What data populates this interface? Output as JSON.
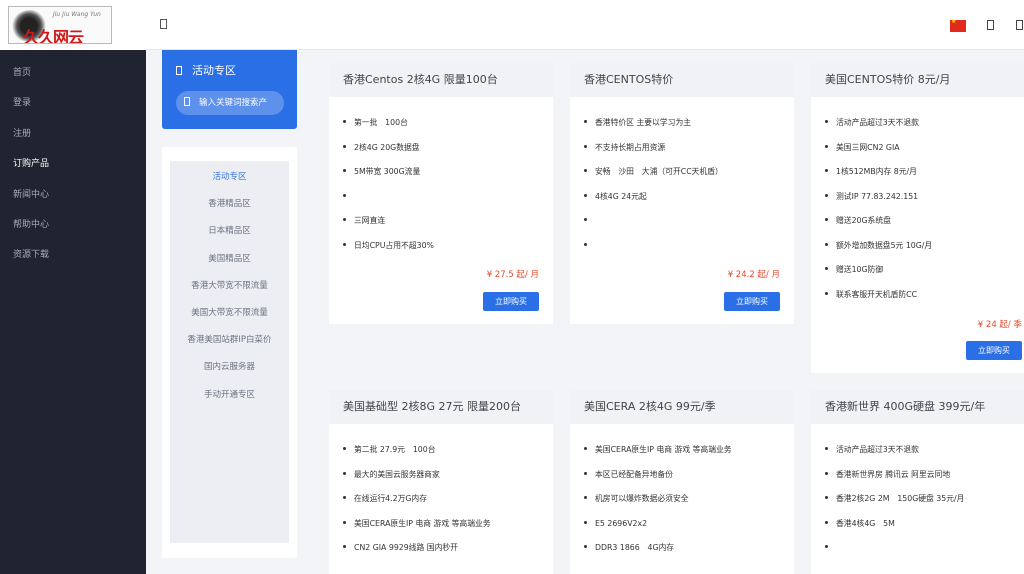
{
  "brand": {
    "logo_text": "久久网云",
    "logo_tagline": "Jiu Jiu Wang Yun"
  },
  "sidebar": {
    "items": [
      {
        "label": "首页"
      },
      {
        "label": "登录"
      },
      {
        "label": "注册"
      },
      {
        "label": "订购产品",
        "active": true
      },
      {
        "label": "新闻中心"
      },
      {
        "label": "帮助中心"
      },
      {
        "label": "资源下载"
      }
    ]
  },
  "topbar": {
    "menu_icon": "menu-toggle-icon",
    "language_flag": "china-flag",
    "icons": [
      "cart-icon",
      "user-icon"
    ]
  },
  "promo": {
    "title": "活动专区",
    "search_placeholder": "输入关键词搜索产"
  },
  "categories": [
    {
      "label": "活动专区",
      "active": true
    },
    {
      "label": "香港精品区"
    },
    {
      "label": "日本精品区"
    },
    {
      "label": "美国精品区"
    },
    {
      "label": "香港大带宽不限流量"
    },
    {
      "label": "美国大带宽不限流量"
    },
    {
      "label": "香港美国站群IP白菜价"
    },
    {
      "label": "国内云服务器"
    },
    {
      "label": "手动开通专区"
    }
  ],
  "colors": {
    "accent": "#2b6fe6",
    "price": "#e84a2c",
    "sidebar_bg": "#1f2430"
  },
  "products": [
    {
      "title": "香港Centos 2核4G 限量100台",
      "features": [
        "第一批　100台",
        "2核4G 20G数据盘",
        "5M带宽 300G流量",
        "",
        "三网直连",
        "日均CPU占用不超30%"
      ],
      "price": "¥ 27.5 起/ 月",
      "buy_label": "立即购买"
    },
    {
      "title": "香港CENTOS特价",
      "features": [
        "香港特价区 主要以学习为主",
        "不支持长期占用资源",
        "安畅　沙田　大浦（可开CC天机盾）",
        "4核4G 24元起",
        "",
        ""
      ],
      "price": "¥ 24.2 起/ 月",
      "buy_label": "立即购买"
    },
    {
      "title": "美国CENTOS特价 8元/月",
      "features": [
        "活动产品超过3天不退款",
        "美国三网CN2 GIA",
        "1核512MB内存 8元/月",
        "测试IP 77.83.242.151",
        "赠送20G系统盘",
        "额外增加数据盘5元 10G/月",
        "赠送10G防御",
        "联系客服开天机盾防CC"
      ],
      "price": "¥ 24 起/ 季",
      "buy_label": "立即购买"
    },
    {
      "title": "美国基础型 2核8G 27元 限量200台",
      "features": [
        "第二批 27.9元　100台",
        "最大的美国云服务器商家",
        "在线运行4.2万G内存",
        "美国CERA原生IP 电商 游戏 等高端业务",
        "CN2 GIA 9929线路 国内秒开"
      ],
      "price": "",
      "buy_label": ""
    },
    {
      "title": "美国CERA 2核4G 99元/季",
      "features": [
        "美国CERA原生IP 电商 游戏 等高端业务",
        "本区已经配备异地备份",
        "机房可以爆炸数据必须安全",
        "E5 2696V2x2",
        "DDR3 1866　4G内存"
      ],
      "price": "",
      "buy_label": ""
    },
    {
      "title": "香港新世界 400G硬盘 399元/年",
      "features": [
        "活动产品超过3天不退款",
        "香港新世界房 腾讯云 阿里云同地",
        "香港2核2G 2M　150G硬盘 35元/月",
        "香港4核4G　5M",
        ""
      ],
      "price": "",
      "buy_label": ""
    }
  ]
}
